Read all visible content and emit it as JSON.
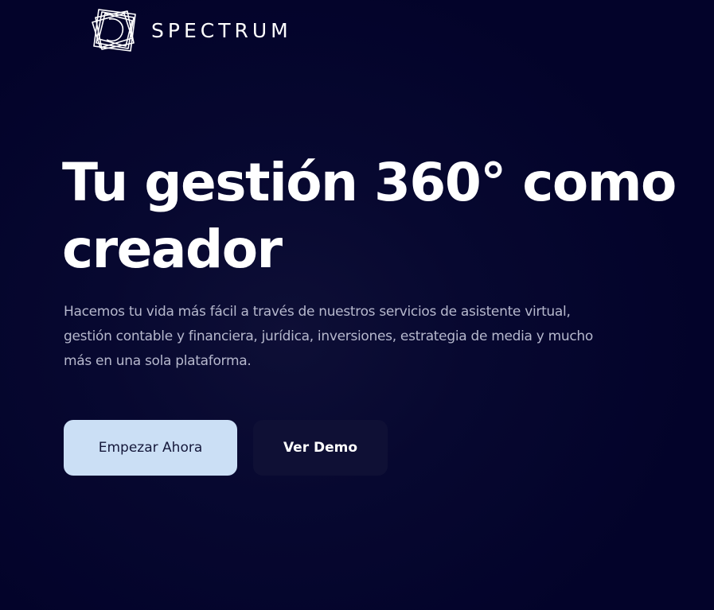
{
  "header": {
    "brand_name": "SPECTRUM",
    "logo_icon": "spectrum-logo-icon"
  },
  "hero": {
    "title": "Tu gestión 360° como creador",
    "subtitle": "Hacemos tu vida más fácil a través de nuestros servicios de asistente virtual, gestión contable y financiera, jurídica, inversiones, estrategia de media y mucho más en una sola plataforma."
  },
  "actions": {
    "primary_label": "Empezar Ahora",
    "secondary_label": "Ver Demo"
  },
  "colors": {
    "background": "#03032a",
    "primary_button": "#cbdff5",
    "secondary_button": "#0f1035",
    "subtitle_text": "#b6b8cd"
  }
}
